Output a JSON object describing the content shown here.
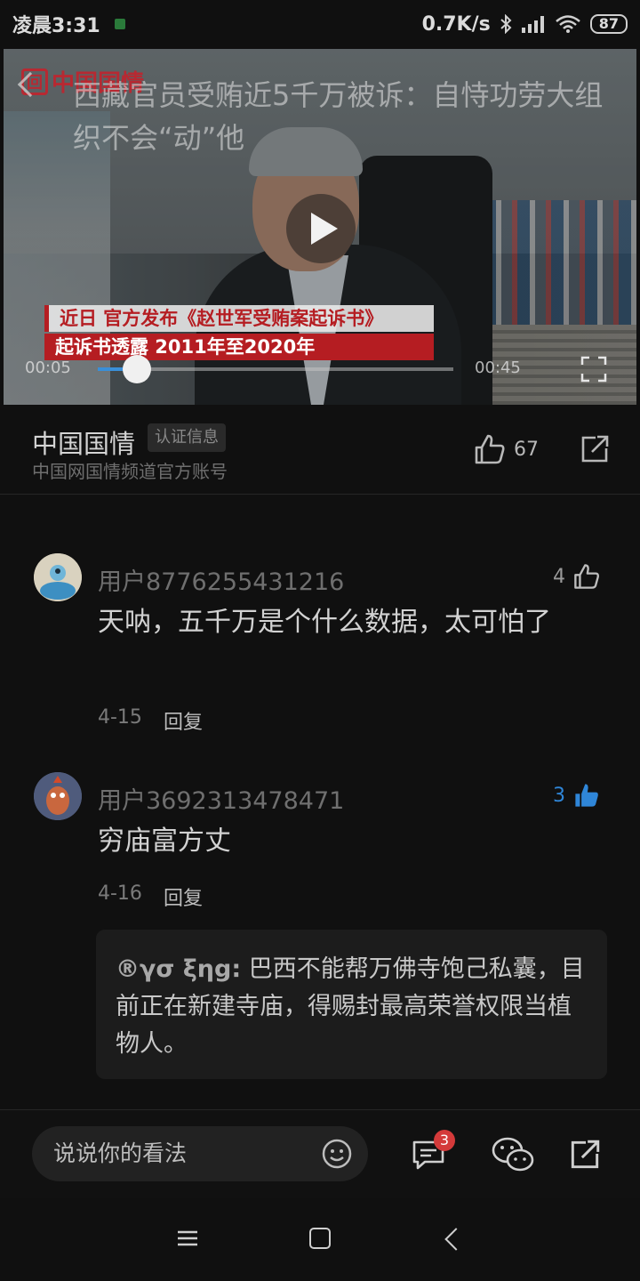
{
  "status_bar": {
    "time": "凌晨3:31",
    "network_speed": "0.7K/s",
    "battery": "87"
  },
  "video": {
    "channel_logo_text": "中国国情",
    "title": "西藏官员受贿近5千万被诉：自恃功劳大组织不会“动”他",
    "caption_line1": "近日 官方发布《赵世军受贿案起诉书》",
    "caption_line2": "起诉书透露 2011年至2020年",
    "current_time": "00:05",
    "total_time": "00:45",
    "progress": 0.11
  },
  "author": {
    "name": "中国国情",
    "badge": "认证信息",
    "description": "中国网国情频道官方账号",
    "like_count": "67"
  },
  "comments": [
    {
      "user": "用户8776255431216",
      "likes": "4",
      "text": "天呐，五千万是个什么数据，太可怕了",
      "date": "4-15",
      "reply_label": "回复"
    },
    {
      "user": "用户3692313478471",
      "likes": "3",
      "text": "穷庙富方丈",
      "date": "4-16",
      "reply_label": "回复",
      "reply": {
        "user": "®γσ ξηg:",
        "text": "巴西不能帮万佛寺饱己私囊，目前正在新建寺庙，得赐封最高荣誉权限当植物人。"
      }
    }
  ],
  "bottom_bar": {
    "input_placeholder": "说说你的看法",
    "comment_count": "3"
  },
  "icons": {
    "accent_blue": "#2f86d8",
    "badge_red": "#d43a3a",
    "caption_red": "#b51d22"
  }
}
